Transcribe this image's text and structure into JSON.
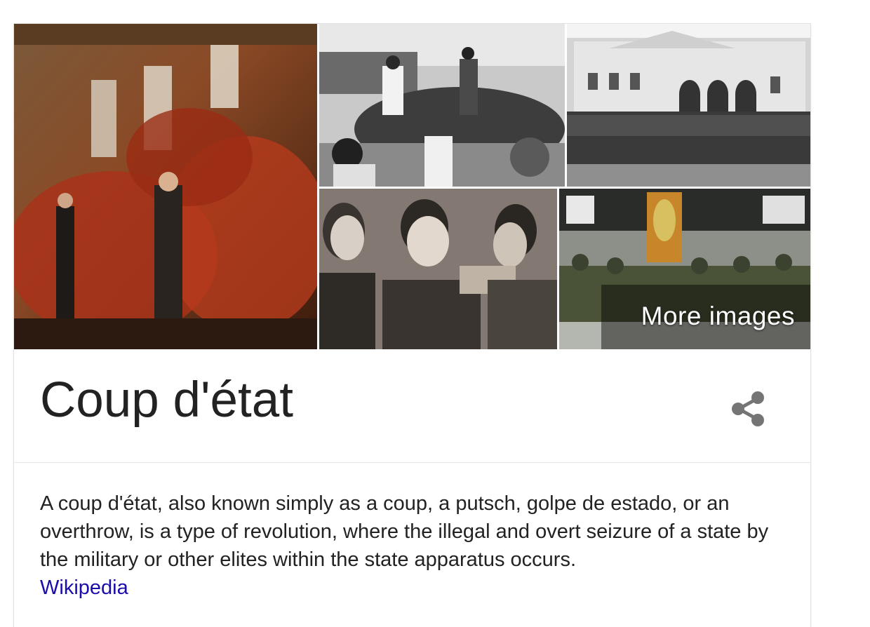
{
  "knowledge_panel": {
    "images": [
      {
        "alt": "painting-crowd-assembly"
      },
      {
        "alt": "photo-crowd-on-tank"
      },
      {
        "alt": "photo-crowd-before-building"
      },
      {
        "alt": "photo-men-grabbing-face"
      },
      {
        "alt": "photo-soldiers-in-front-of-building"
      }
    ],
    "more_images_label": "More images",
    "title": "Coup d'état",
    "share_icon": "share-icon",
    "description": "A coup d'état, also known simply as a coup, a putsch, golpe de estado, or an overthrow, is a type of revolution, where the illegal and overt seizure of a state by the military or other elites within the state apparatus occurs.",
    "source_link": "Wikipedia"
  },
  "colors": {
    "title_text": "#222222",
    "link": "#1a0dab",
    "share_icon": "#757575",
    "divider": "#e6e6e6"
  }
}
